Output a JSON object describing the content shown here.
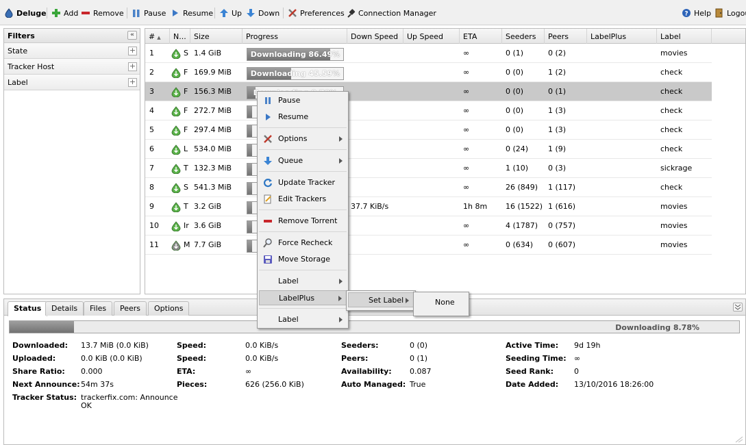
{
  "toolbar": {
    "app_name": "Deluge",
    "add": "Add",
    "remove": "Remove",
    "pause": "Pause",
    "resume": "Resume",
    "up": "Up",
    "down": "Down",
    "preferences": "Preferences",
    "connection_manager": "Connection Manager",
    "help": "Help",
    "logout": "Logout"
  },
  "sidebar": {
    "title": "Filters",
    "collapse": "«",
    "items": [
      {
        "label": "State",
        "plus": "+"
      },
      {
        "label": "Tracker Host",
        "plus": "+"
      },
      {
        "label": "Label",
        "plus": "+"
      }
    ]
  },
  "grid": {
    "columns": [
      "#",
      "N...",
      "Size",
      "Progress",
      "Down Speed",
      "Up Speed",
      "ETA",
      "Seeders",
      "Peers",
      "LabelPlus",
      "Label"
    ],
    "sort_arrow": "▲",
    "rows": [
      {
        "num": "1",
        "name": "S",
        "size": "1.4 GiB",
        "progress": 0.8649,
        "progress_text": "Downloading 86.49%",
        "down": "",
        "up": "",
        "eta": "∞",
        "seeders": "0 (1)",
        "peers": "0 (2)",
        "labelplus": "",
        "label": "movies"
      },
      {
        "num": "2",
        "name": "F",
        "size": "169.9 MiB",
        "progress": 0.4559,
        "progress_text": "Downloading 45.59%",
        "down": "",
        "up": "",
        "eta": "∞",
        "seeders": "0 (0)",
        "peers": "1 (2)",
        "labelplus": "",
        "label": "check"
      },
      {
        "num": "3",
        "name": "F",
        "size": "156.3 MiB",
        "progress": 0.0878,
        "progress_text": "Downloading 8.78%",
        "down": "",
        "up": "",
        "eta": "∞",
        "seeders": "0 (0)",
        "peers": "0 (1)",
        "labelplus": "",
        "label": "check"
      },
      {
        "num": "4",
        "name": "F",
        "size": "272.7 MiB",
        "progress": 0.05,
        "progress_text": "",
        "down": "",
        "up": "",
        "eta": "∞",
        "seeders": "0 (0)",
        "peers": "1 (3)",
        "labelplus": "",
        "label": "check"
      },
      {
        "num": "5",
        "name": "F",
        "size": "297.4 MiB",
        "progress": 0.05,
        "progress_text": "",
        "down": "",
        "up": "",
        "eta": "∞",
        "seeders": "0 (0)",
        "peers": "1 (3)",
        "labelplus": "",
        "label": "check"
      },
      {
        "num": "6",
        "name": "L",
        "size": "534.0 MiB",
        "progress": 0.05,
        "progress_text": "",
        "down": "",
        "up": "",
        "eta": "∞",
        "seeders": "0 (24)",
        "peers": "1 (9)",
        "labelplus": "",
        "label": "check"
      },
      {
        "num": "7",
        "name": "T",
        "size": "132.3 MiB",
        "progress": 0.05,
        "progress_text": "",
        "down": "",
        "up": "",
        "eta": "∞",
        "seeders": "1 (10)",
        "peers": "0 (3)",
        "labelplus": "",
        "label": "sickrage"
      },
      {
        "num": "8",
        "name": "S",
        "size": "541.3 MiB",
        "progress": 0.05,
        "progress_text": "",
        "down": "",
        "up": "",
        "eta": "∞",
        "seeders": "26 (849)",
        "peers": "1 (117)",
        "labelplus": "",
        "label": "check"
      },
      {
        "num": "9",
        "name": "T",
        "size": "3.2 GiB",
        "progress": 0.05,
        "progress_text": "",
        "down": "37.7 KiB/s",
        "up": "",
        "eta": "1h 8m",
        "seeders": "16 (1522)",
        "peers": "1 (616)",
        "labelplus": "",
        "label": "movies"
      },
      {
        "num": "10",
        "name": "Ir",
        "size": "3.6 GiB",
        "progress": 0.05,
        "progress_text": "",
        "down": "",
        "up": "",
        "eta": "∞",
        "seeders": "4 (1787)",
        "peers": "0 (757)",
        "labelplus": "",
        "label": "movies"
      },
      {
        "num": "11",
        "name": "M",
        "size": "7.7 GiB",
        "progress": 0.05,
        "progress_text": "",
        "down": "",
        "up": "",
        "eta": "∞",
        "seeders": "0 (634)",
        "peers": "0 (607)",
        "labelplus": "",
        "label": "movies"
      }
    ]
  },
  "context_menu": {
    "items": [
      "Pause",
      "Resume",
      "Options",
      "Queue",
      "Update Tracker",
      "Edit Trackers",
      "Remove Torrent",
      "Force Recheck",
      "Move Storage",
      "Label",
      "LabelPlus",
      "Label"
    ],
    "submenu": {
      "set_label": "Set Label"
    },
    "subsubmenu": {
      "none": "None"
    }
  },
  "details": {
    "tabs": [
      "Status",
      "Details",
      "Files",
      "Peers",
      "Options"
    ],
    "progress": 0.0878,
    "progress_text": "Downloading 8.78%",
    "labels": {
      "downloaded": "Downloaded:",
      "uploaded": "Uploaded:",
      "share_ratio": "Share Ratio:",
      "next_announce": "Next Announce:",
      "tracker_status": "Tracker Status:",
      "speed1": "Speed:",
      "speed2": "Speed:",
      "eta": "ETA:",
      "pieces": "Pieces:",
      "seeders": "Seeders:",
      "peers": "Peers:",
      "availability": "Availability:",
      "auto_managed": "Auto Managed:",
      "active_time": "Active Time:",
      "seeding_time": "Seeding Time:",
      "seed_rank": "Seed Rank:",
      "date_added": "Date Added:"
    },
    "values": {
      "downloaded": "13.7 MiB (0.0 KiB)",
      "uploaded": "0.0 KiB (0.0 KiB)",
      "share_ratio": "0.000",
      "next_announce": "54m 37s",
      "tracker_status_1": "trackerfix.com: Announce",
      "tracker_status_2": "OK",
      "speed1": "0.0 KiB/s",
      "speed2": "0.0 KiB/s",
      "eta": "∞",
      "pieces": "626 (256.0 KiB)",
      "seeders": "0 (0)",
      "peers": "0 (1)",
      "availability": "0.087",
      "auto_managed": "True",
      "active_time": "9d 19h",
      "seeding_time": "∞",
      "seed_rank": "0",
      "date_added": "13/10/2016 18:26:00"
    }
  }
}
